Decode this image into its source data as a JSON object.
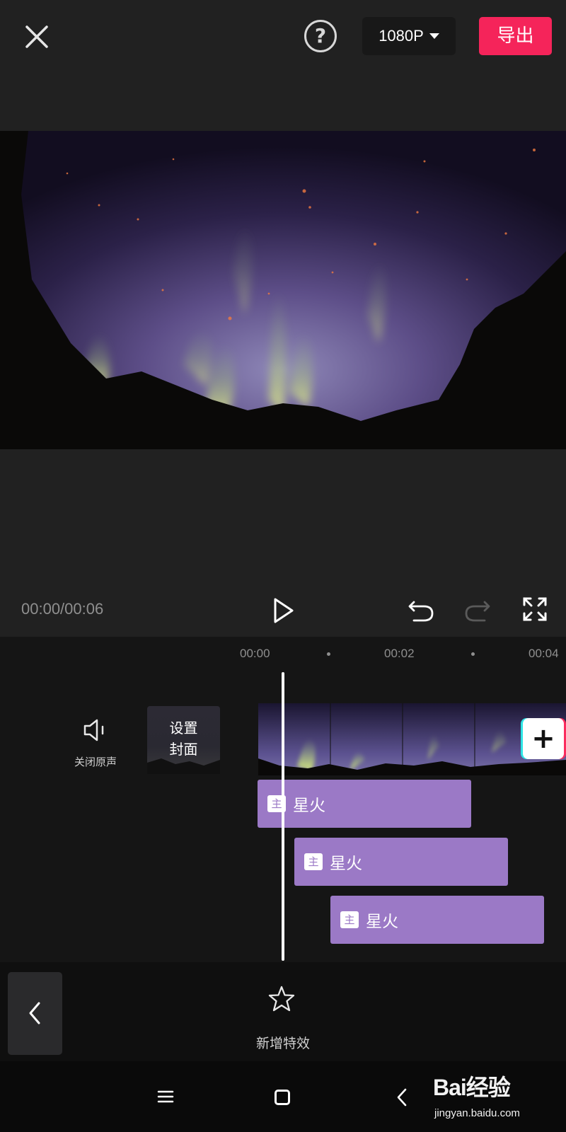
{
  "header": {
    "resolution": "1080P",
    "export_label": "导出",
    "help_symbol": "?"
  },
  "player": {
    "time": "00:00/00:06"
  },
  "timeline": {
    "ruler": [
      "00:00",
      "00:02",
      "00:04"
    ],
    "mute_label": "关闭原声",
    "cover_line1": "设置",
    "cover_line2": "封面",
    "add_clip_symbol": "+",
    "effects": [
      {
        "badge": "主",
        "label": "星火"
      },
      {
        "badge": "主",
        "label": "星火"
      },
      {
        "badge": "主",
        "label": "星火"
      }
    ]
  },
  "bottom": {
    "add_effect_label": "新增特效"
  },
  "watermark": {
    "main": "Bai经验",
    "sub": "jingyan.baidu.com"
  },
  "colors": {
    "accent_red": "#f5245a",
    "effect_purple": "#9b79c6",
    "background": "#1c1c1e"
  }
}
